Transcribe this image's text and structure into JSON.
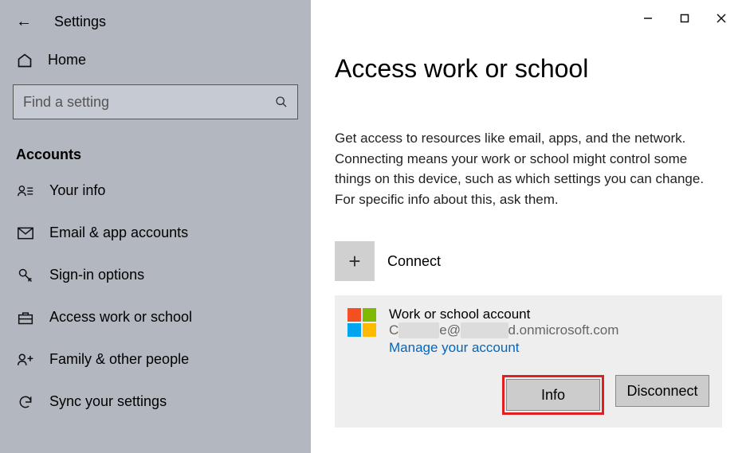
{
  "window": {
    "app_title": "Settings",
    "minimize": "—",
    "maximize": "☐",
    "close": "✕"
  },
  "sidebar": {
    "home_label": "Home",
    "search_placeholder": "Find a setting",
    "section": "Accounts",
    "items": [
      {
        "label": "Your info"
      },
      {
        "label": "Email & app accounts"
      },
      {
        "label": "Sign-in options"
      },
      {
        "label": "Access work or school"
      },
      {
        "label": "Family & other people"
      },
      {
        "label": "Sync your settings"
      }
    ]
  },
  "main": {
    "title": "Access work or school",
    "description": "Get access to resources like email, apps, and the network. Connecting means your work or school might control some things on this device, such as which settings you can change. For specific info about this, ask them.",
    "connect_label": "Connect",
    "account": {
      "title": "Work or school account",
      "email_prefix": "C",
      "email_obscured1": "xxxxxx",
      "email_mid": "e@",
      "email_obscured2": "xxxxxxx",
      "email_suffix": "d.onmicrosoft.com",
      "manage_link": "Manage your account"
    },
    "info_btn": "Info",
    "disconnect_btn": "Disconnect"
  }
}
